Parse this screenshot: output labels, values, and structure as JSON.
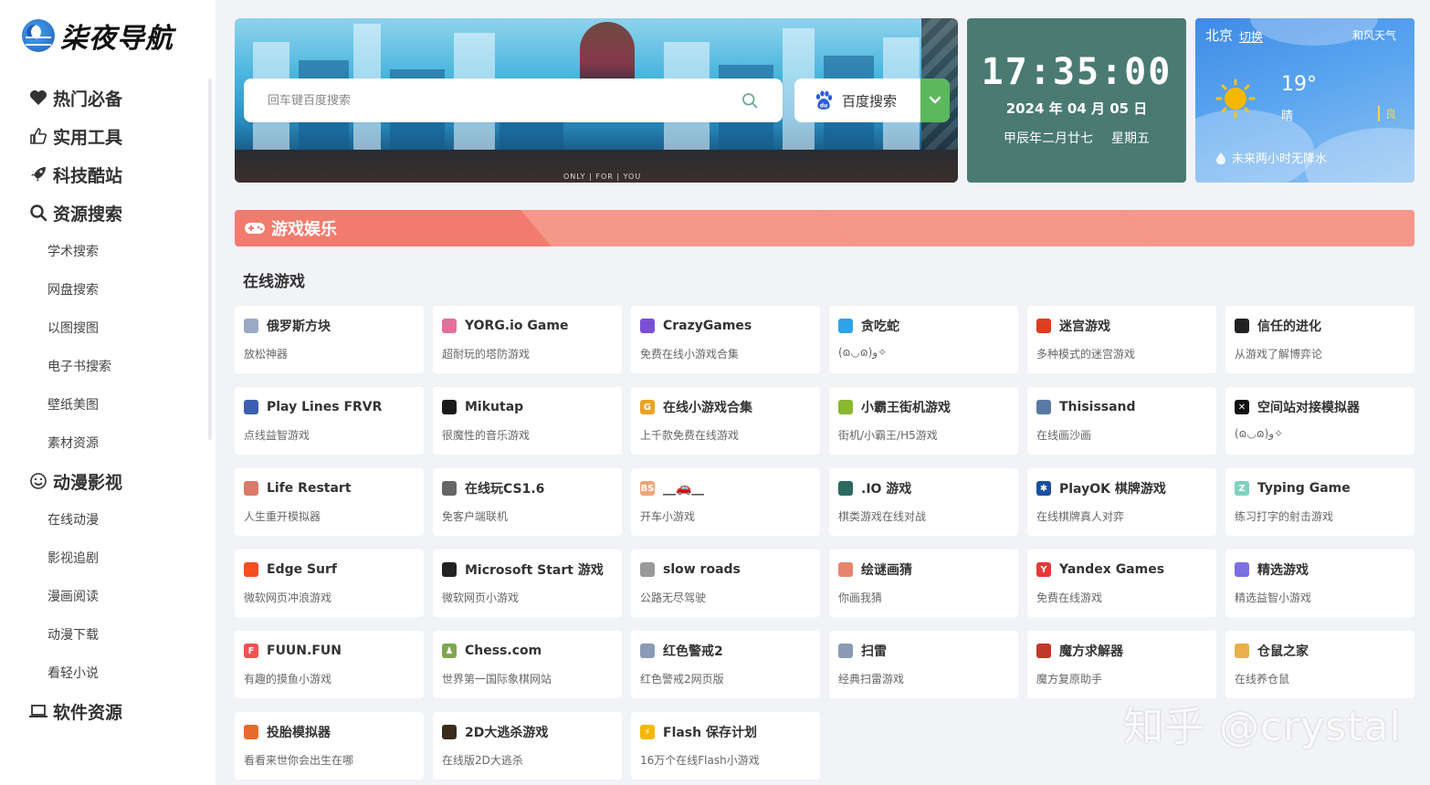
{
  "logo": {
    "text": "柒夜导航"
  },
  "nav": {
    "items": [
      {
        "type": "cat",
        "label": "热门必备",
        "icon": "heart-icon"
      },
      {
        "type": "cat",
        "label": "实用工具",
        "icon": "thumbs-up-icon"
      },
      {
        "type": "cat",
        "label": "科技酷站",
        "icon": "rocket-icon"
      },
      {
        "type": "cat",
        "label": "资源搜索",
        "icon": "search-icon"
      },
      {
        "type": "sub",
        "label": "学术搜索"
      },
      {
        "type": "sub",
        "label": "网盘搜索"
      },
      {
        "type": "sub",
        "label": "以图搜图"
      },
      {
        "type": "sub",
        "label": "电子书搜索"
      },
      {
        "type": "sub",
        "label": "壁纸美图"
      },
      {
        "type": "sub",
        "label": "素材资源"
      },
      {
        "type": "cat",
        "label": "动漫影视",
        "icon": "smile-icon"
      },
      {
        "type": "sub",
        "label": "在线动漫"
      },
      {
        "type": "sub",
        "label": "影视追剧"
      },
      {
        "type": "sub",
        "label": "漫画阅读"
      },
      {
        "type": "sub",
        "label": "动漫下载"
      },
      {
        "type": "sub",
        "label": "看轻小说"
      },
      {
        "type": "cat",
        "label": "软件资源",
        "icon": "laptop-icon"
      }
    ]
  },
  "banner": {
    "footer_text": "ONLY | FOR | YOU"
  },
  "search": {
    "placeholder": "回车键百度搜索",
    "engine_label": "百度搜索"
  },
  "clock": {
    "time": "17:35:00",
    "date": "2024 年 04 月 05 日",
    "lunar": "甲辰年二月廿七",
    "weekday": "星期五"
  },
  "weather": {
    "city": "北京",
    "switch_label": "切换",
    "brand": "和风天气",
    "temp": "19°",
    "condition": "晴",
    "aqi": "良",
    "forecast": "未来两小时无降水"
  },
  "section": {
    "title": "游戏娱乐",
    "subtitle": "在线游戏"
  },
  "cards": [
    {
      "title": "俄罗斯方块",
      "desc": "放松神器",
      "icon_text": "",
      "color": "#9aa9c4"
    },
    {
      "title": "YORG.io Game",
      "desc": "超耐玩的塔防游戏",
      "icon_text": "",
      "color": "#e66e9a"
    },
    {
      "title": "CrazyGames",
      "desc": "免费在线小游戏合集",
      "icon_text": "",
      "color": "#7b4fd6"
    },
    {
      "title": "贪吃蛇",
      "desc": "(ɷ◡ɷ)و✧",
      "icon_text": "",
      "color": "#2fa3e8"
    },
    {
      "title": "迷宫游戏",
      "desc": "多种模式的迷宫游戏",
      "icon_text": "",
      "color": "#d9401f"
    },
    {
      "title": "信任的进化",
      "desc": "从游戏了解博弈论",
      "icon_text": "",
      "color": "#222222"
    },
    {
      "title": "Play Lines FRVR",
      "desc": "点线益智游戏",
      "icon_text": "",
      "color": "#3d5fb0"
    },
    {
      "title": "Mikutap",
      "desc": "很魔性的音乐游戏",
      "icon_text": "",
      "color": "#1a1a1a"
    },
    {
      "title": "在线小游戏合集",
      "desc": "上千款免费在线游戏",
      "icon_text": "G",
      "color": "#e9a326"
    },
    {
      "title": "小霸王街机游戏",
      "desc": "街机/小霸王/H5游戏",
      "icon_text": "",
      "color": "#8ab82f"
    },
    {
      "title": "Thisissand",
      "desc": "在线画沙画",
      "icon_text": "",
      "color": "#5a7aa3"
    },
    {
      "title": "空间站对接模拟器",
      "desc": "(ɷ◡ɷ)و✧",
      "icon_text": "✕",
      "color": "#111111"
    },
    {
      "title": "Life Restart",
      "desc": "人生重开模拟器",
      "icon_text": "",
      "color": "#d97a6a"
    },
    {
      "title": "在线玩CS1.6",
      "desc": "免客户端联机",
      "icon_text": "",
      "color": "#666666"
    },
    {
      "title": "__🚗__",
      "desc": "开车小游戏",
      "icon_text": "BS",
      "color": "#f0a47a"
    },
    {
      "title": ".IO 游戏",
      "desc": "棋类游戏在线对战",
      "icon_text": "",
      "color": "#2b6b5f"
    },
    {
      "title": "PlayOK 棋牌游戏",
      "desc": "在线棋牌真人对弈",
      "icon_text": "✱",
      "color": "#1a4fa0"
    },
    {
      "title": "Typing Game",
      "desc": "练习打字的射击游戏",
      "icon_text": "Z",
      "color": "#7fd1c0"
    },
    {
      "title": "Edge Surf",
      "desc": "微软网页冲浪游戏",
      "icon_text": "",
      "color": "#f25022"
    },
    {
      "title": "Microsoft Start 游戏",
      "desc": "微软网页小游戏",
      "icon_text": "",
      "color": "#222222"
    },
    {
      "title": "slow roads",
      "desc": "公路无尽驾驶",
      "icon_text": "",
      "color": "#999999"
    },
    {
      "title": "绘谜画猜",
      "desc": "你画我猜",
      "icon_text": "",
      "color": "#e6856f"
    },
    {
      "title": "Yandex Games",
      "desc": "免费在线游戏",
      "icon_text": "Y",
      "color": "#e53935"
    },
    {
      "title": "精选游戏",
      "desc": "精选益智小游戏",
      "icon_text": "",
      "color": "#7c6fe0"
    },
    {
      "title": "FUUN.FUN",
      "desc": "有趣的摸鱼小游戏",
      "icon_text": "F",
      "color": "#ef5350"
    },
    {
      "title": "Chess.com",
      "desc": "世界第一国际象棋网站",
      "icon_text": "♟",
      "color": "#7fa650"
    },
    {
      "title": "红色警戒2",
      "desc": "红色警戒2网页版",
      "icon_text": "",
      "color": "#8a9bb5"
    },
    {
      "title": "扫雷",
      "desc": "经典扫雷游戏",
      "icon_text": "",
      "color": "#8a9bb5"
    },
    {
      "title": "魔方求解器",
      "desc": "魔方复原助手",
      "icon_text": "",
      "color": "#c0392b"
    },
    {
      "title": "仓鼠之家",
      "desc": "在线养仓鼠",
      "icon_text": "",
      "color": "#e8b04a"
    },
    {
      "title": "投胎模拟器",
      "desc": "看看来世你会出生在哪",
      "icon_text": "",
      "color": "#e86a2a"
    },
    {
      "title": "2D大逃杀游戏",
      "desc": "在线版2D大逃杀",
      "icon_text": "",
      "color": "#3a2a1a"
    },
    {
      "title": "Flash 保存计划",
      "desc": "16万个在线Flash小游戏",
      "icon_text": "⚡",
      "color": "#f5b800"
    }
  ],
  "watermark": "知乎 @crystal"
}
